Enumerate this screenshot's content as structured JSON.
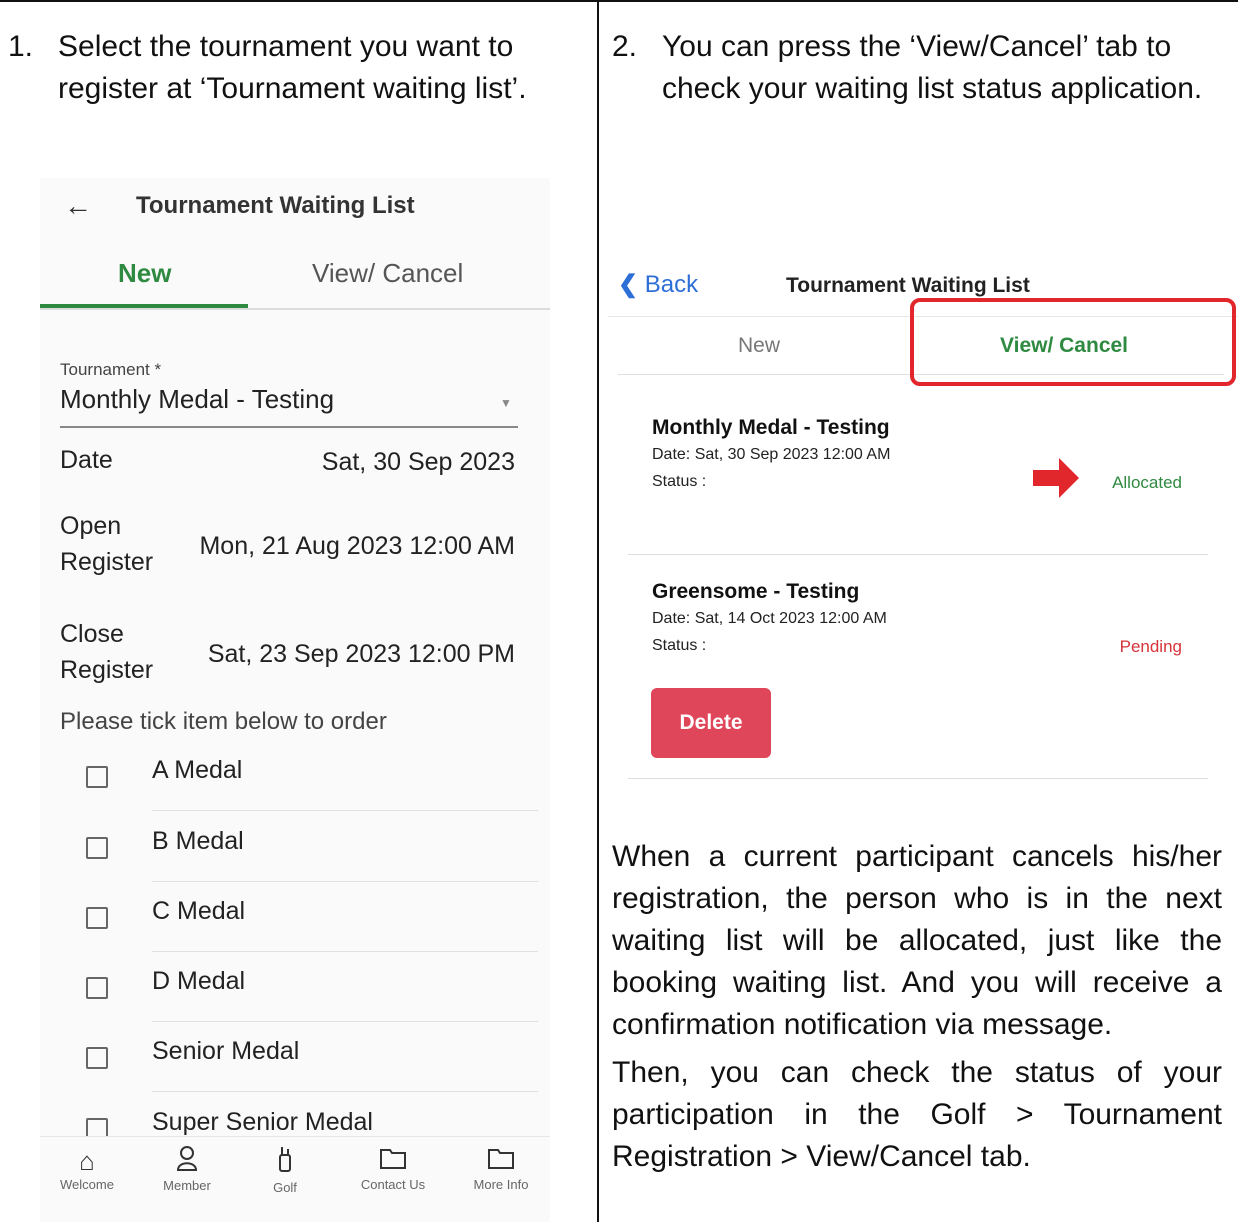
{
  "step1": {
    "number": "1.",
    "text": "Select the tournament you want to register at ‘Tournament waiting list’."
  },
  "step2": {
    "number": "2.",
    "text": "You can press the ‘View/Cancel’ tab to check your waiting list status application."
  },
  "screen1": {
    "back_glyph": "←",
    "title": "Tournament Waiting List",
    "tabs": {
      "new": "New",
      "view_cancel": "View/ Cancel"
    },
    "tournament_label": "Tournament *",
    "tournament_value": "Monthly Medal - Testing",
    "rows": [
      {
        "label": "Date",
        "value": "Sat, 30 Sep 2023"
      },
      {
        "label": "Open Register",
        "value": "Mon, 21 Aug 2023 12:00 AM"
      },
      {
        "label": "Close Register",
        "value": "Sat, 23 Sep 2023 12:00 PM"
      }
    ],
    "note": "Please tick item below to order",
    "items": [
      "A Medal",
      "B Medal",
      "C Medal",
      "D Medal",
      "Senior Medal",
      "Super Senior Medal"
    ],
    "nav": [
      {
        "label": "Welcome",
        "icon": "home-icon"
      },
      {
        "label": "Member",
        "icon": "person-icon"
      },
      {
        "label": "Golf",
        "icon": "golf-bag-icon"
      },
      {
        "label": "Contact Us",
        "icon": "folder-icon"
      },
      {
        "label": "More Info",
        "icon": "folder-icon"
      }
    ]
  },
  "screen2": {
    "back": "Back",
    "title": "Tournament Waiting List",
    "tabs": {
      "new": "New",
      "view_cancel": "View/ Cancel"
    },
    "highlight_color": "#e1262c",
    "cards": [
      {
        "name": "Monthly Medal - Testing",
        "date": "Date: Sat, 30 Sep 2023 12:00 AM",
        "status_label": "Status :",
        "status": "Allocated",
        "status_color": "#2f8a41"
      },
      {
        "name": "Greensome - Testing",
        "date": "Date: Sat, 14 Oct 2023 12:00 AM",
        "status_label": "Status :",
        "status": "Pending",
        "status_color": "#d6333a"
      }
    ],
    "delete_label": "Delete"
  },
  "paragraphs": [
    "When a current participant cancels his/her registration, the person who is in the next waiting list will be allocated, just like the booking waiting list. And you will receive a confirmation notification via message.",
    "Then, you can check the status of your participation in the Golf > Tournament Registration > View/Cancel tab."
  ]
}
